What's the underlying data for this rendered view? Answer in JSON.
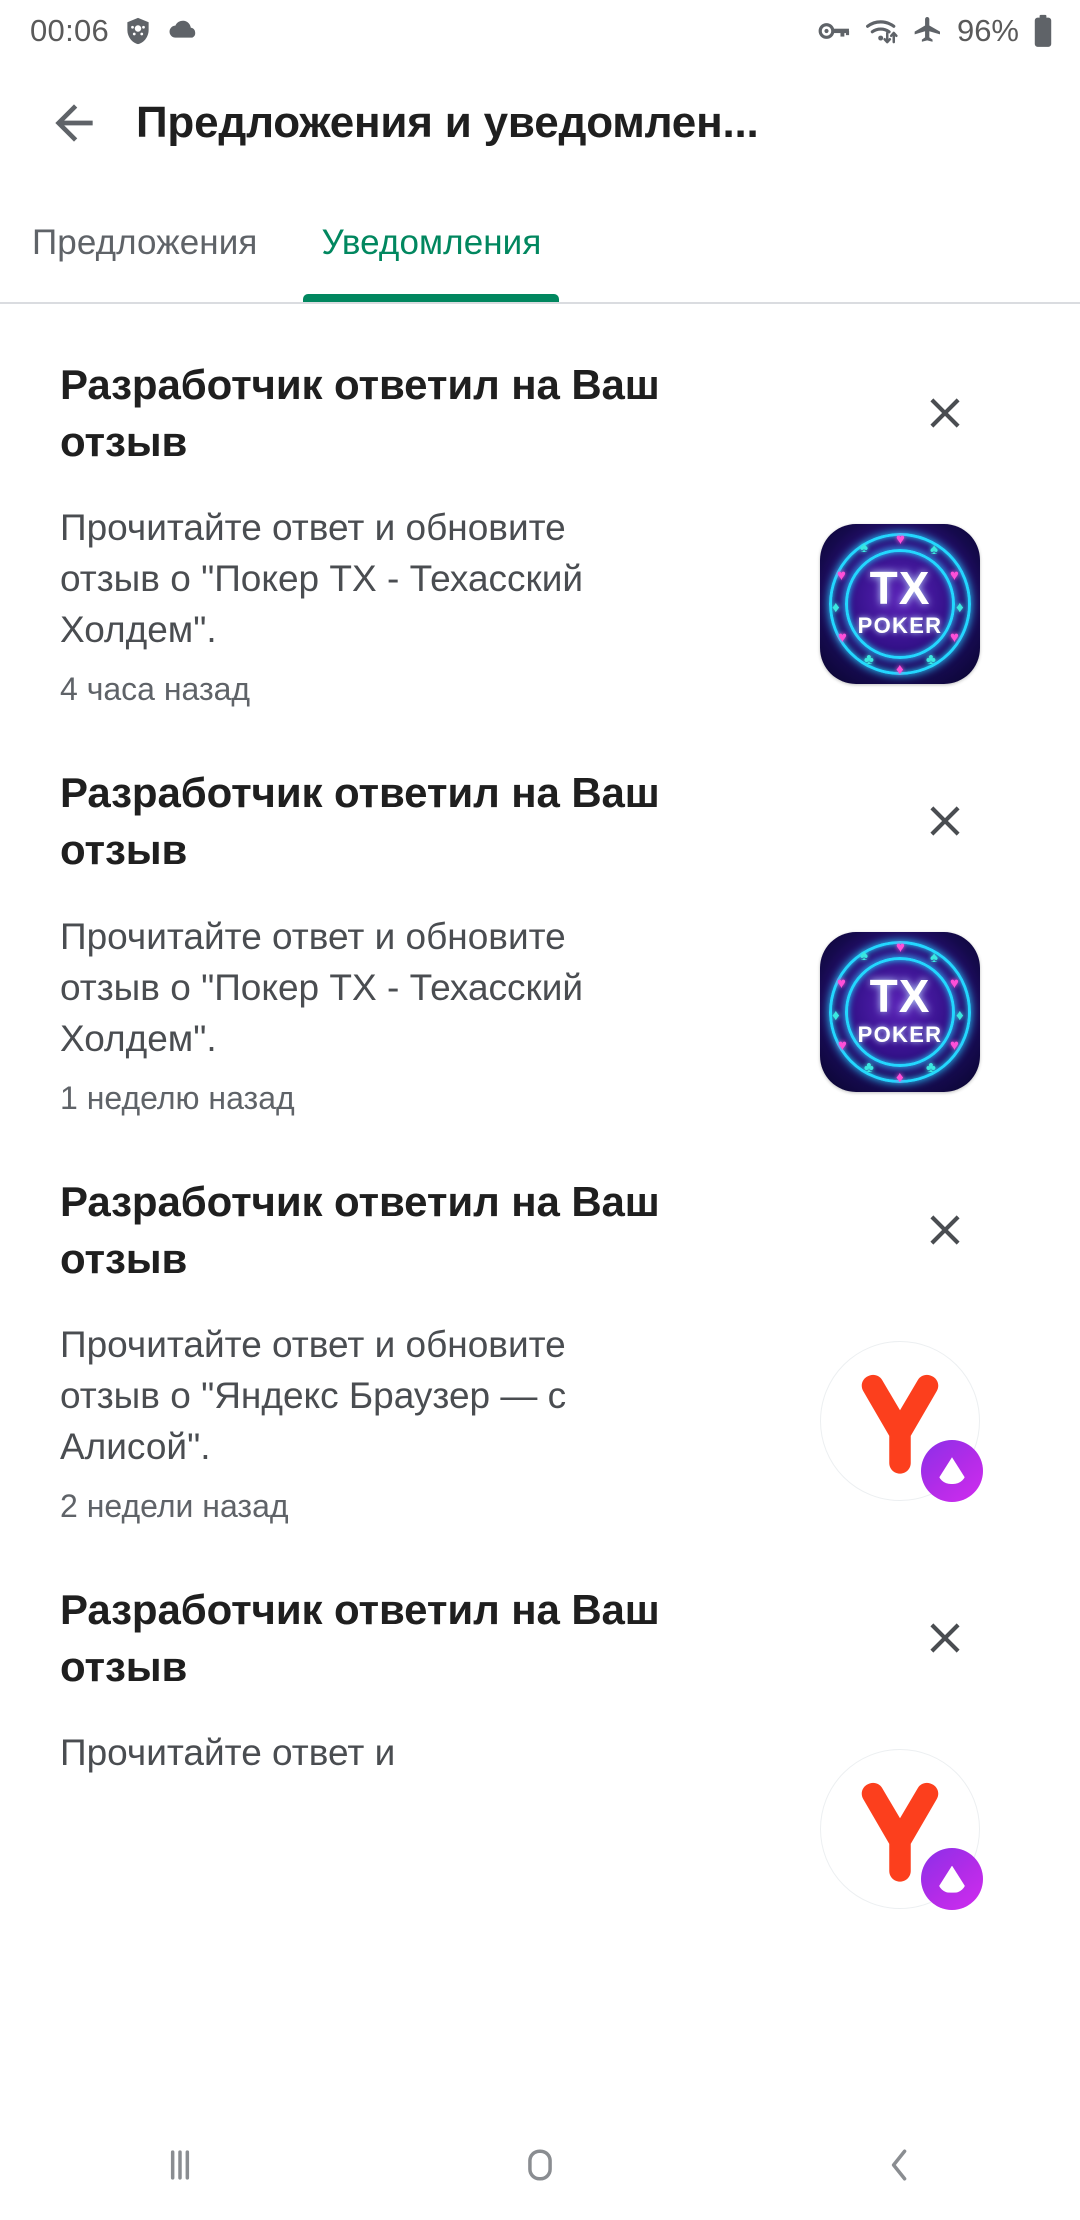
{
  "status_bar": {
    "time": "00:06",
    "battery_percent": "96%",
    "icons": [
      "shield-icon",
      "cloud-icon",
      "vpn-key-icon",
      "wifi-data-icon",
      "airplane-mode-icon",
      "battery-icon"
    ]
  },
  "app_bar": {
    "back_icon": "back-arrow-icon",
    "title": "Предложения и уведомлен..."
  },
  "tabs": [
    {
      "label": "Предложения",
      "active": false
    },
    {
      "label": "Уведомления",
      "active": true
    }
  ],
  "colors": {
    "accent_green": "#01875f",
    "title_black": "#1f1f1f",
    "body_gray": "#4a4d51",
    "meta_gray": "#5f6368",
    "divider": "#dadce0"
  },
  "notifications": [
    {
      "title": "Разработчик ответил на Ваш отзыв",
      "body": "Прочитайте ответ и обновите отзыв о \"Покер TX - Техасский Холдем\".",
      "time": "4 часа назад",
      "app": "tx-poker",
      "app_icon_text": {
        "line1": "TX",
        "line2": "POKER"
      },
      "dismiss_icon": "close-icon"
    },
    {
      "title": "Разработчик ответил на Ваш отзыв",
      "body": "Прочитайте ответ и обновите отзыв о \"Покер TX - Техасский Холдем\".",
      "time": "1 неделю назад",
      "app": "tx-poker",
      "app_icon_text": {
        "line1": "TX",
        "line2": "POKER"
      },
      "dismiss_icon": "close-icon"
    },
    {
      "title": "Разработчик ответил на Ваш отзыв",
      "body": "Прочитайте ответ и обновите отзыв о \"Яндекс Браузер — с Алисой\".",
      "time": "2 недели назад",
      "app": "yandex-browser",
      "app_icon_text": {
        "line1": "Y",
        "line2": ""
      },
      "dismiss_icon": "close-icon"
    },
    {
      "title": "Разработчик ответил на Ваш отзыв",
      "body": "Прочитайте ответ и",
      "time": "",
      "app": "yandex-browser",
      "app_icon_text": {
        "line1": "Y",
        "line2": ""
      },
      "dismiss_icon": "close-icon"
    }
  ],
  "nav_bar": {
    "recents": "recents-icon",
    "home": "home-icon",
    "back": "back-icon"
  }
}
